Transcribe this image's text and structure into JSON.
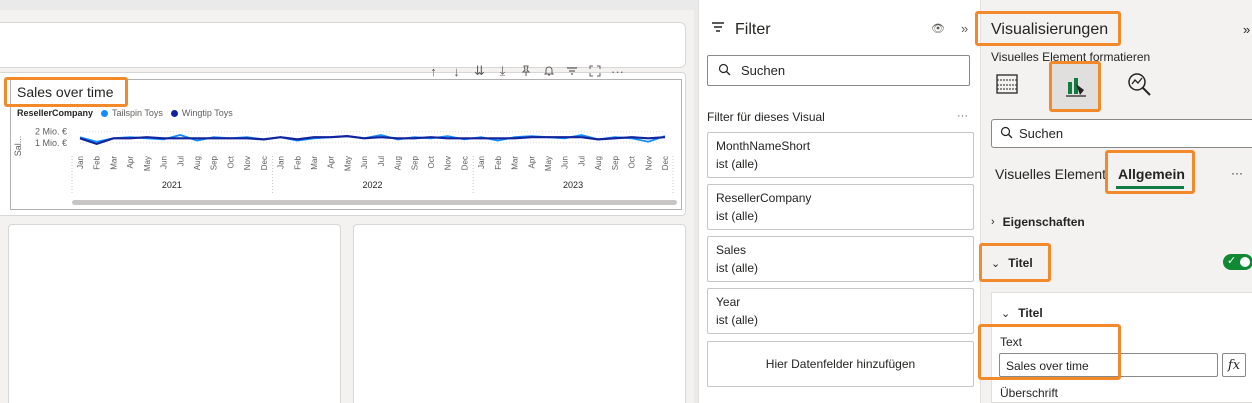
{
  "canvas": {
    "chart": {
      "title": "Sales over time",
      "legend": {
        "label": "ResellerCompany",
        "entries": [
          {
            "name": "Tailspin Toys",
            "color": "#118dff"
          },
          {
            "name": "Wingtip Toys",
            "color": "#12239e"
          }
        ]
      },
      "y_axis_label": "Sal...",
      "y_ticks": [
        "2 Mio. €",
        "1 Mio. €"
      ],
      "months": [
        "Jan",
        "Feb",
        "Mar",
        "Apr",
        "May",
        "Jun",
        "Jul",
        "Aug",
        "Sep",
        "Oct",
        "Nov",
        "Dec"
      ],
      "years": [
        "2021",
        "2022",
        "2023"
      ]
    },
    "toolbar_icons": [
      "arrow-up-icon",
      "arrow-down-icon",
      "double-arrow-down-icon",
      "expand-hierarchy-icon",
      "pin-icon",
      "bell-icon",
      "filter-icon",
      "focus-mode-icon",
      "more-options-icon"
    ]
  },
  "chart_data": {
    "type": "line",
    "title": "Sales over time",
    "xlabel": "",
    "ylabel": "Sal...",
    "x": [
      "Jan 2021",
      "Feb 2021",
      "Mar 2021",
      "Apr 2021",
      "May 2021",
      "Jun 2021",
      "Jul 2021",
      "Aug 2021",
      "Sep 2021",
      "Oct 2021",
      "Nov 2021",
      "Dec 2021",
      "Jan 2022",
      "Feb 2022",
      "Mar 2022",
      "Apr 2022",
      "May 2022",
      "Jun 2022",
      "Jul 2022",
      "Aug 2022",
      "Sep 2022",
      "Oct 2022",
      "Nov 2022",
      "Dec 2022",
      "Jan 2023",
      "Feb 2023",
      "Mar 2023",
      "Apr 2023",
      "May 2023",
      "Jun 2023",
      "Jul 2023",
      "Aug 2023",
      "Sep 2023",
      "Oct 2023",
      "Nov 2023",
      "Dec 2023"
    ],
    "series": [
      {
        "name": "Tailspin Toys",
        "values": [
          1.5,
          1.1,
          1.4,
          1.5,
          1.4,
          1.3,
          1.7,
          1.2,
          1.5,
          1.4,
          1.5,
          1.3,
          1.5,
          1.2,
          1.4,
          1.5,
          1.6,
          1.4,
          1.7,
          1.3,
          1.5,
          1.4,
          1.6,
          1.3,
          1.5,
          1.2,
          1.5,
          1.6,
          1.5,
          1.4,
          1.7,
          1.3,
          1.5,
          1.4,
          1.1,
          1.6
        ]
      },
      {
        "name": "Wingtip Toys",
        "values": [
          1.4,
          0.9,
          1.4,
          1.4,
          1.5,
          1.4,
          1.4,
          1.4,
          1.4,
          1.4,
          1.4,
          1.3,
          1.5,
          1.3,
          1.5,
          1.5,
          1.6,
          1.4,
          1.5,
          1.4,
          1.4,
          1.5,
          1.4,
          1.4,
          1.4,
          1.4,
          1.4,
          1.5,
          1.5,
          1.5,
          1.5,
          1.3,
          1.4,
          1.5,
          1.4,
          1.5
        ]
      }
    ],
    "ylim": [
      0,
      2.5
    ],
    "y_ticks": [
      "2 Mio. €",
      "1 Mio. €"
    ],
    "grid": true,
    "legend_position": "top-left"
  },
  "filter_pane": {
    "title": "Filter",
    "search_placeholder": "Suchen",
    "section_label": "Filter für dieses Visual",
    "more": "···",
    "cards": [
      {
        "field": "MonthNameShort",
        "value": "ist (alle)"
      },
      {
        "field": "ResellerCompany",
        "value": "ist (alle)"
      },
      {
        "field": "Sales",
        "value": "ist (alle)"
      },
      {
        "field": "Year",
        "value": "ist (alle)"
      }
    ],
    "add_fields": "Hier Datenfelder hinzufügen"
  },
  "viz_pane": {
    "title": "Visualisierungen",
    "subtitle": "Visuelles Element formatieren",
    "search_placeholder": "Suchen",
    "tabs": [
      "Visuelles Element",
      "Allgemein"
    ],
    "more": "···",
    "properties_label": "Eigenschaften",
    "title_section": "Titel",
    "title_subsection": "Titel",
    "text_label": "Text",
    "text_value": "Sales over time",
    "fx_label": "fx",
    "subheading_label": "Überschrift",
    "toggle_on": true,
    "highlight_color": "#f28a2b"
  }
}
